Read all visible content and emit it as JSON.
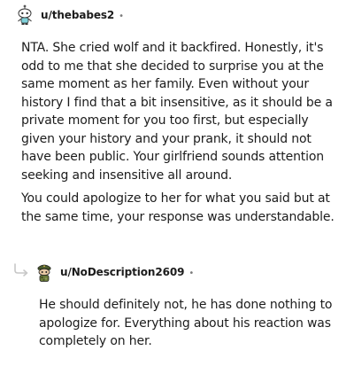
{
  "comments": [
    {
      "username": "u/thebabes2",
      "separator": "•",
      "avatar_icon": "snoo-avatar-icon",
      "paragraphs": [
        "NTA. She cried wolf and it backfired. Honestly, it's odd to me that she decided to surprise you at the same moment as her family. Even without your history I find that a bit insensitive, as it should be a private moment for you too first, but especially given your history and your prank, it should not have been public. Your girlfriend sounds attention seeking and insensitive all around.",
        "You could apologize to her for what you said but at the same time, your response was understandable."
      ]
    },
    {
      "username": "u/NoDescription2609",
      "separator": "•",
      "avatar_icon": "snoo-avatar-icon",
      "reply_icon": "reply-arrow-icon",
      "paragraphs": [
        "He should definitely not, he has done nothing to apologize for. Everything about his reaction was completely on her."
      ]
    }
  ],
  "colors": {
    "text": "#1c1c1c",
    "meta": "#7c7c7c",
    "reply_line": "#c7c7c7",
    "background": "#ffffff"
  }
}
